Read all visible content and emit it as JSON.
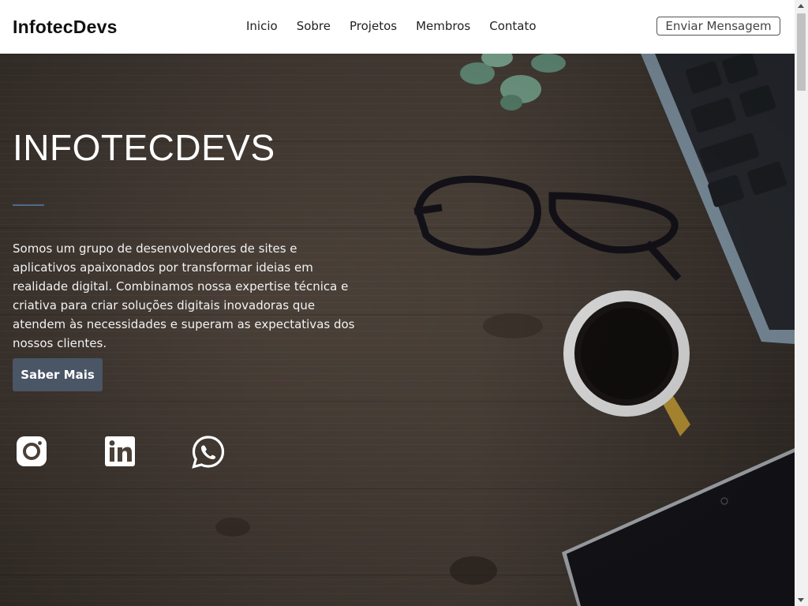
{
  "navbar": {
    "brand": "InfotecDevs",
    "links": [
      "Inicio",
      "Sobre",
      "Projetos",
      "Membros",
      "Contato"
    ],
    "cta_label": "Enviar Mensagem"
  },
  "hero": {
    "title": "INFOTECDEVS",
    "description": "Somos um grupo de desenvolvedores de sites e aplicativos apaixonados por transformar ideias em realidade digital. Combinamos nossa expertise técnica e criativa para criar soluções digitais inovadoras que atendem às necessidades e superam as expectativas dos nossos clientes.",
    "button_label": "Saber Mais",
    "social_icons": [
      "instagram-icon",
      "linkedin-icon",
      "whatsapp-icon"
    ],
    "background_image": "wooden-desk-with-laptop-glasses-coffee-plant"
  },
  "colors": {
    "navbar_bg": "#ffffff",
    "hero_wood": "#4a4038",
    "hero_button": "#4a5566",
    "accent_divider": "#4f6a8a",
    "text_light": "#ffffff"
  }
}
